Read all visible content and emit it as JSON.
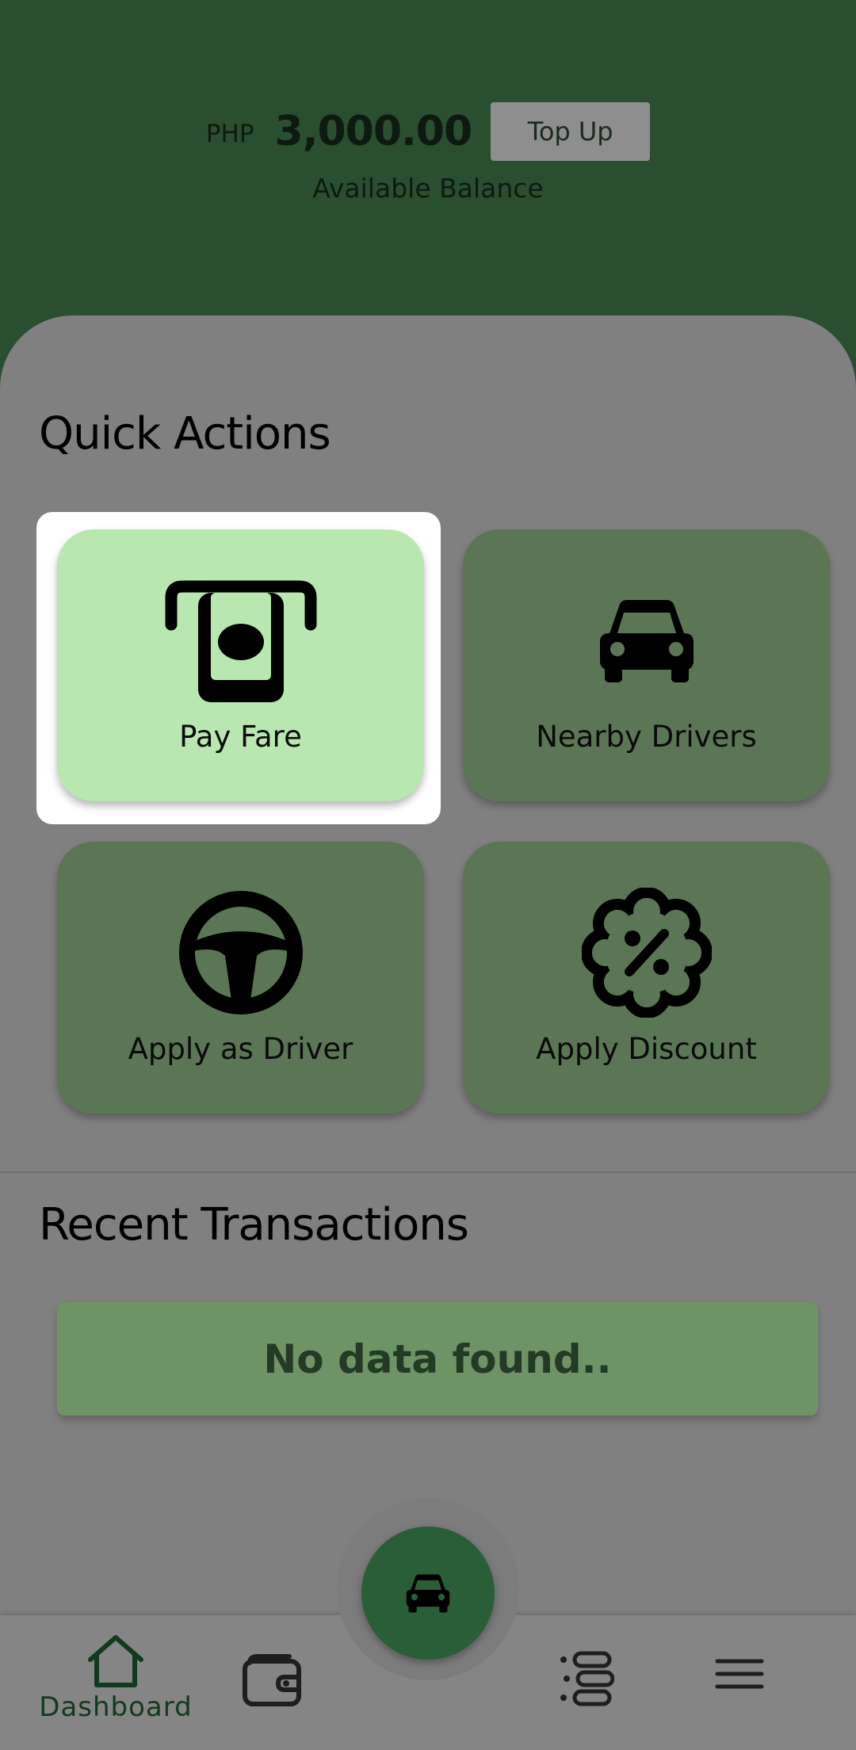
{
  "header": {
    "currency": "PHP",
    "balance": "3,000.00",
    "top_up_label": "Top Up",
    "balance_caption": "Available Balance"
  },
  "quick_actions": {
    "title": "Quick Actions",
    "items": [
      {
        "label": "Pay Fare",
        "icon": "pay-fare-icon",
        "selected": true
      },
      {
        "label": "Nearby Drivers",
        "icon": "car-icon",
        "selected": false
      },
      {
        "label": "Apply as Driver",
        "icon": "steering-wheel-icon",
        "selected": false
      },
      {
        "label": "Apply Discount",
        "icon": "discount-badge-icon",
        "selected": false
      }
    ]
  },
  "recent_transactions": {
    "title": "Recent Transactions",
    "empty_text": "No data found.."
  },
  "bottom_nav": {
    "items": [
      {
        "label": "Dashboard",
        "icon": "home-icon",
        "active": true
      },
      {
        "label": "",
        "icon": "wallet-icon",
        "active": false
      },
      {
        "label": "",
        "icon": "list-icon",
        "active": false
      },
      {
        "label": "",
        "icon": "menu-icon",
        "active": false
      }
    ],
    "fab_icon": "car-icon"
  },
  "colors": {
    "header_bg": "#2a4e30",
    "sheet_bg": "#808080",
    "card_bg": "#5b7655",
    "card_active_bg": "#b8e8b0",
    "fab_bg": "#2a5e36"
  }
}
